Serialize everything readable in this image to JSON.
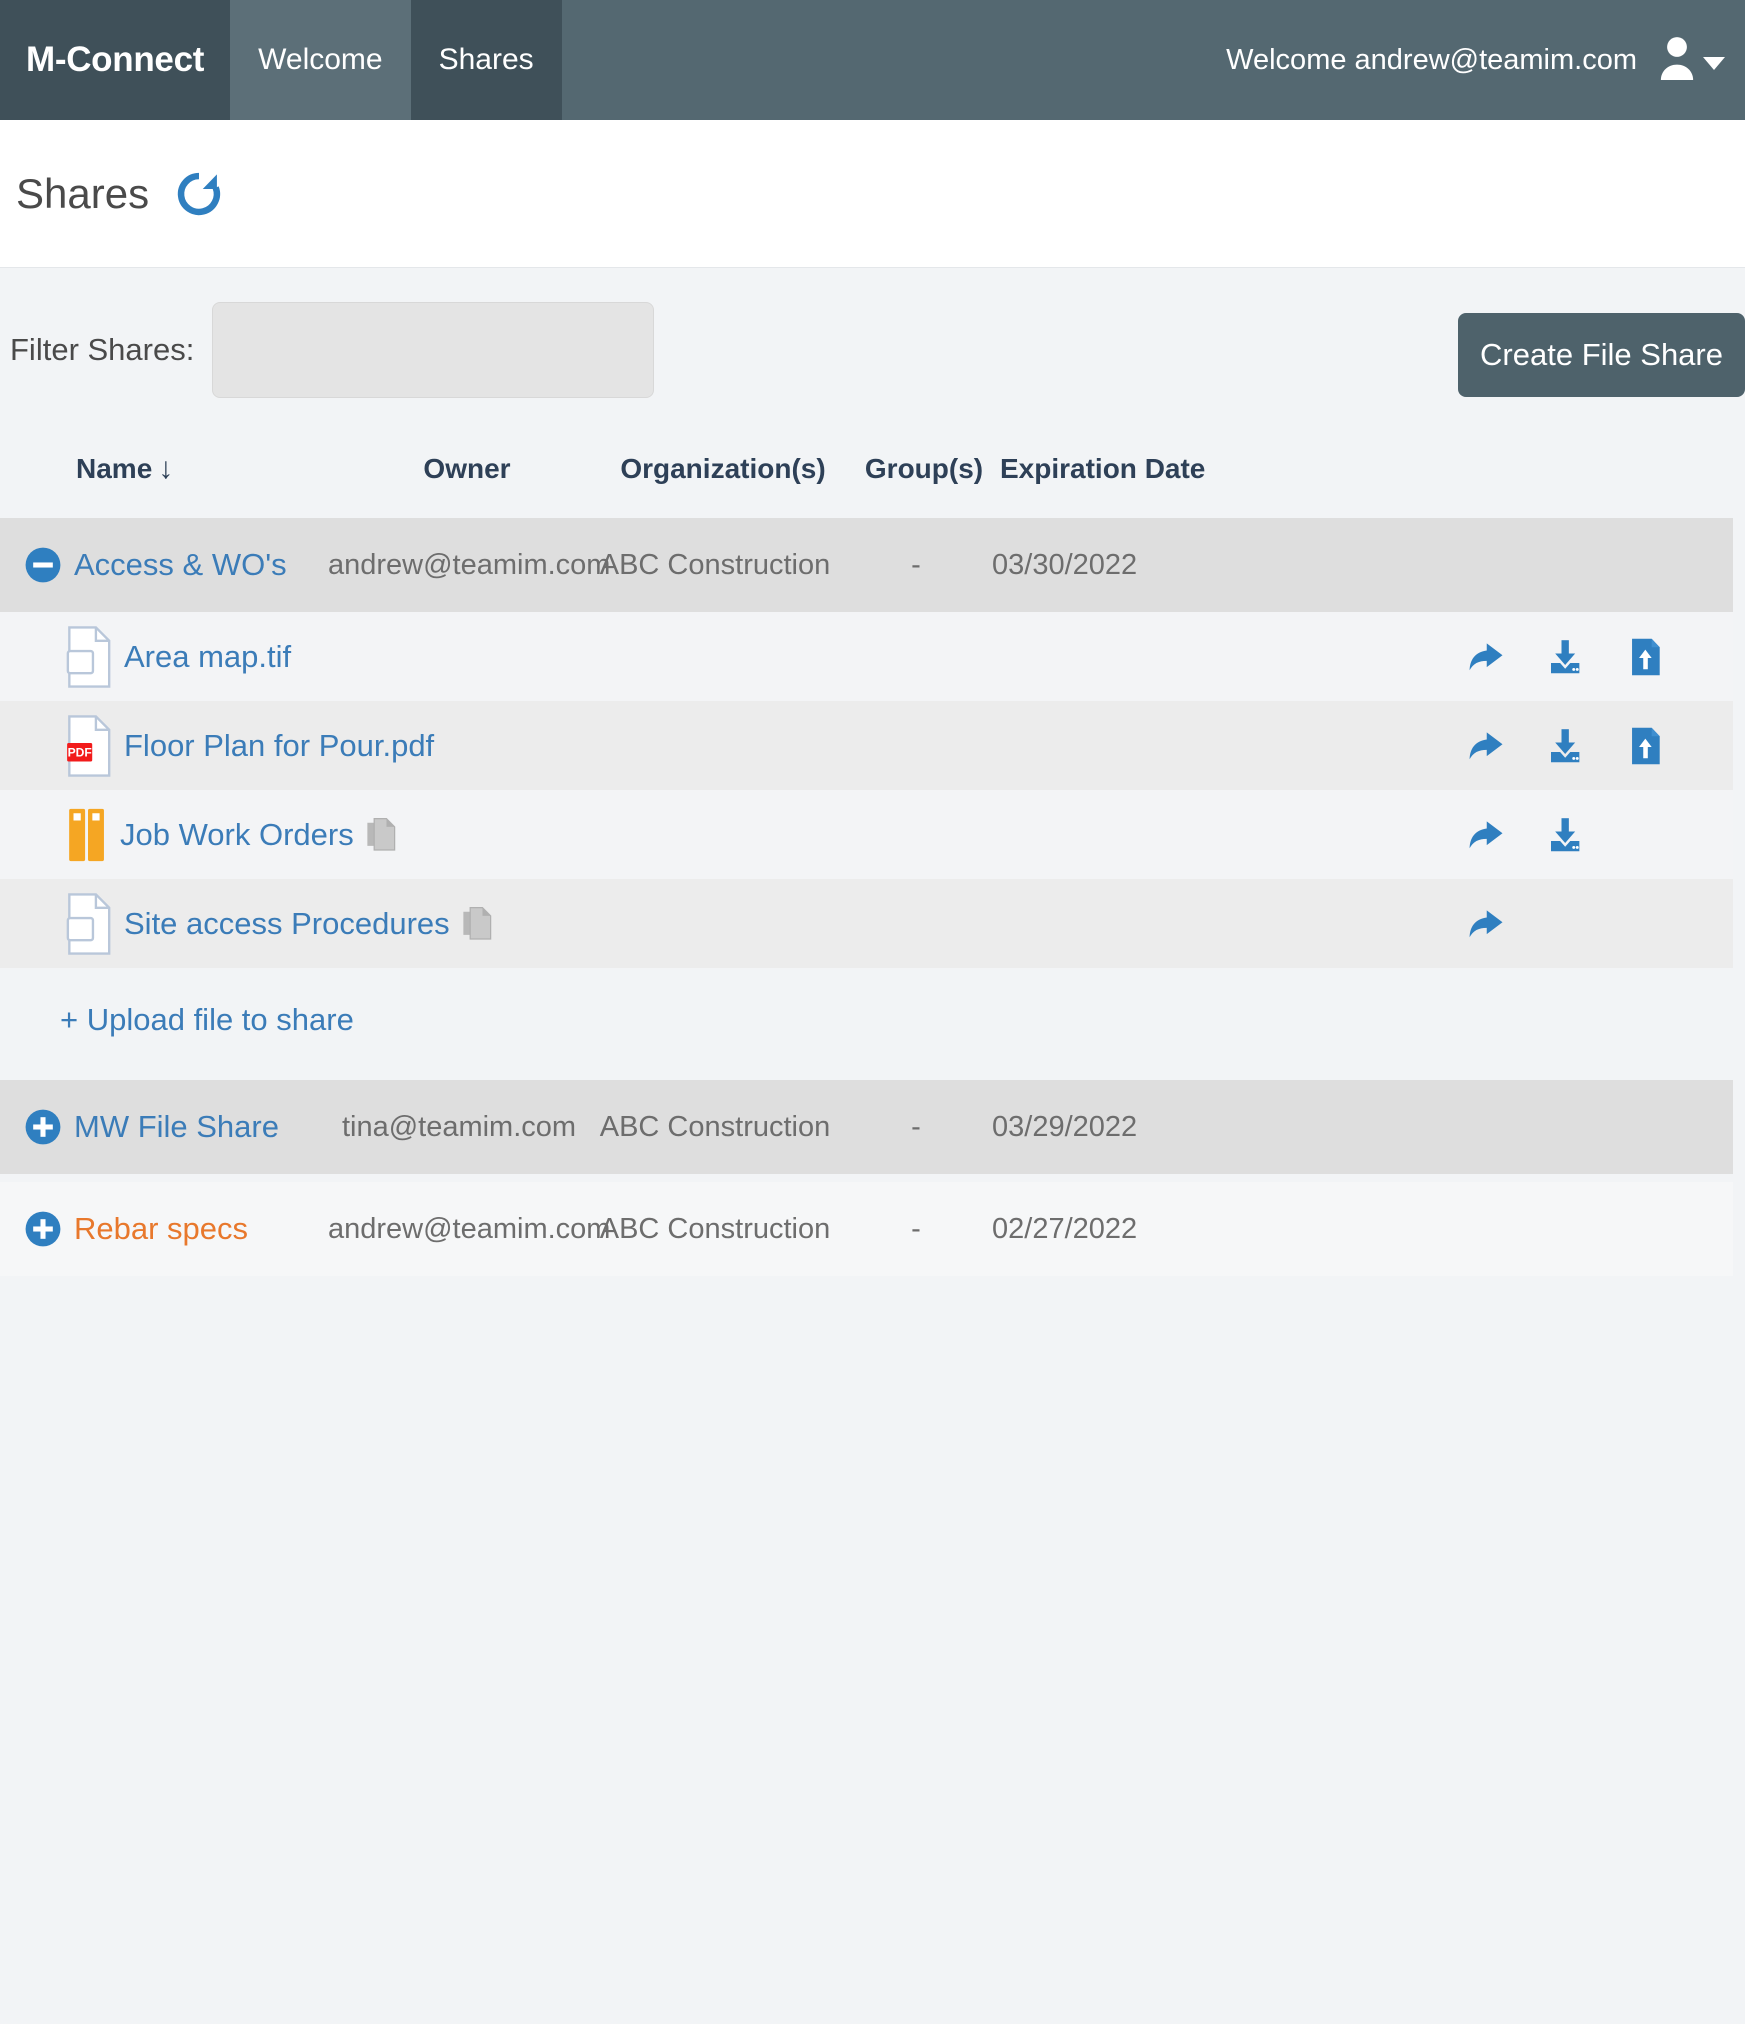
{
  "navbar": {
    "brand": "M-Connect",
    "tabs": [
      {
        "label": "Welcome",
        "active": false
      },
      {
        "label": "Shares",
        "active": true
      }
    ],
    "welcome_text": "Welcome andrew@teamim.com",
    "avatar_icon": "user-avatar-icon",
    "caret_icon": "chevron-down-icon"
  },
  "page": {
    "title": "Shares",
    "refresh_icon": "refresh-icon",
    "accent_blue": "#3b7cb8",
    "accent_orange": "#e8782c",
    "header_bg": "#546871"
  },
  "toolbar": {
    "filter_label": "Filter Shares:",
    "filter_value": "",
    "filter_placeholder": "",
    "create_button": "Create File Share"
  },
  "table": {
    "headers": {
      "name": "Name",
      "sort_arrow": "↓",
      "owner": "Owner",
      "organizations": "Organization(s)",
      "groups": "Group(s)",
      "expiration": "Expiration Date"
    },
    "rows": [
      {
        "name": "Access & WO's",
        "owner": "andrew@teamim.com",
        "organizations": "ABC Construction",
        "groups": "-",
        "expiration": "03/30/2022",
        "expanded": true,
        "name_color": "blue",
        "toggle_icon": "minus-circle-icon"
      },
      {
        "name": "MW File Share",
        "owner": "tina@teamim.com",
        "organizations": "ABC Construction",
        "groups": "-",
        "expiration": "03/29/2022",
        "expanded": false,
        "name_color": "blue",
        "toggle_icon": "plus-circle-icon"
      },
      {
        "name": "Rebar specs",
        "owner": "andrew@teamim.com",
        "organizations": "ABC Construction",
        "groups": "-",
        "expiration": "02/27/2022",
        "expanded": false,
        "name_color": "orange",
        "toggle_icon": "plus-circle-icon"
      }
    ],
    "files": [
      {
        "name": "Area map.tif",
        "icon": "generic-file-icon",
        "multi": false,
        "actions": [
          "share-icon",
          "download-icon",
          "upload-file-icon"
        ]
      },
      {
        "name": "Floor Plan for Pour.pdf",
        "icon": "pdf-file-icon",
        "icon_badge": "PDF",
        "multi": false,
        "actions": [
          "share-icon",
          "download-icon",
          "upload-file-icon"
        ]
      },
      {
        "name": "Job Work Orders",
        "icon": "binder-folder-icon",
        "multi": true,
        "actions": [
          "share-icon",
          "download-icon"
        ]
      },
      {
        "name": "Site access Procedures",
        "icon": "generic-file-icon",
        "multi": true,
        "actions": [
          "share-icon"
        ]
      }
    ],
    "upload_link": "+ Upload file to share"
  }
}
